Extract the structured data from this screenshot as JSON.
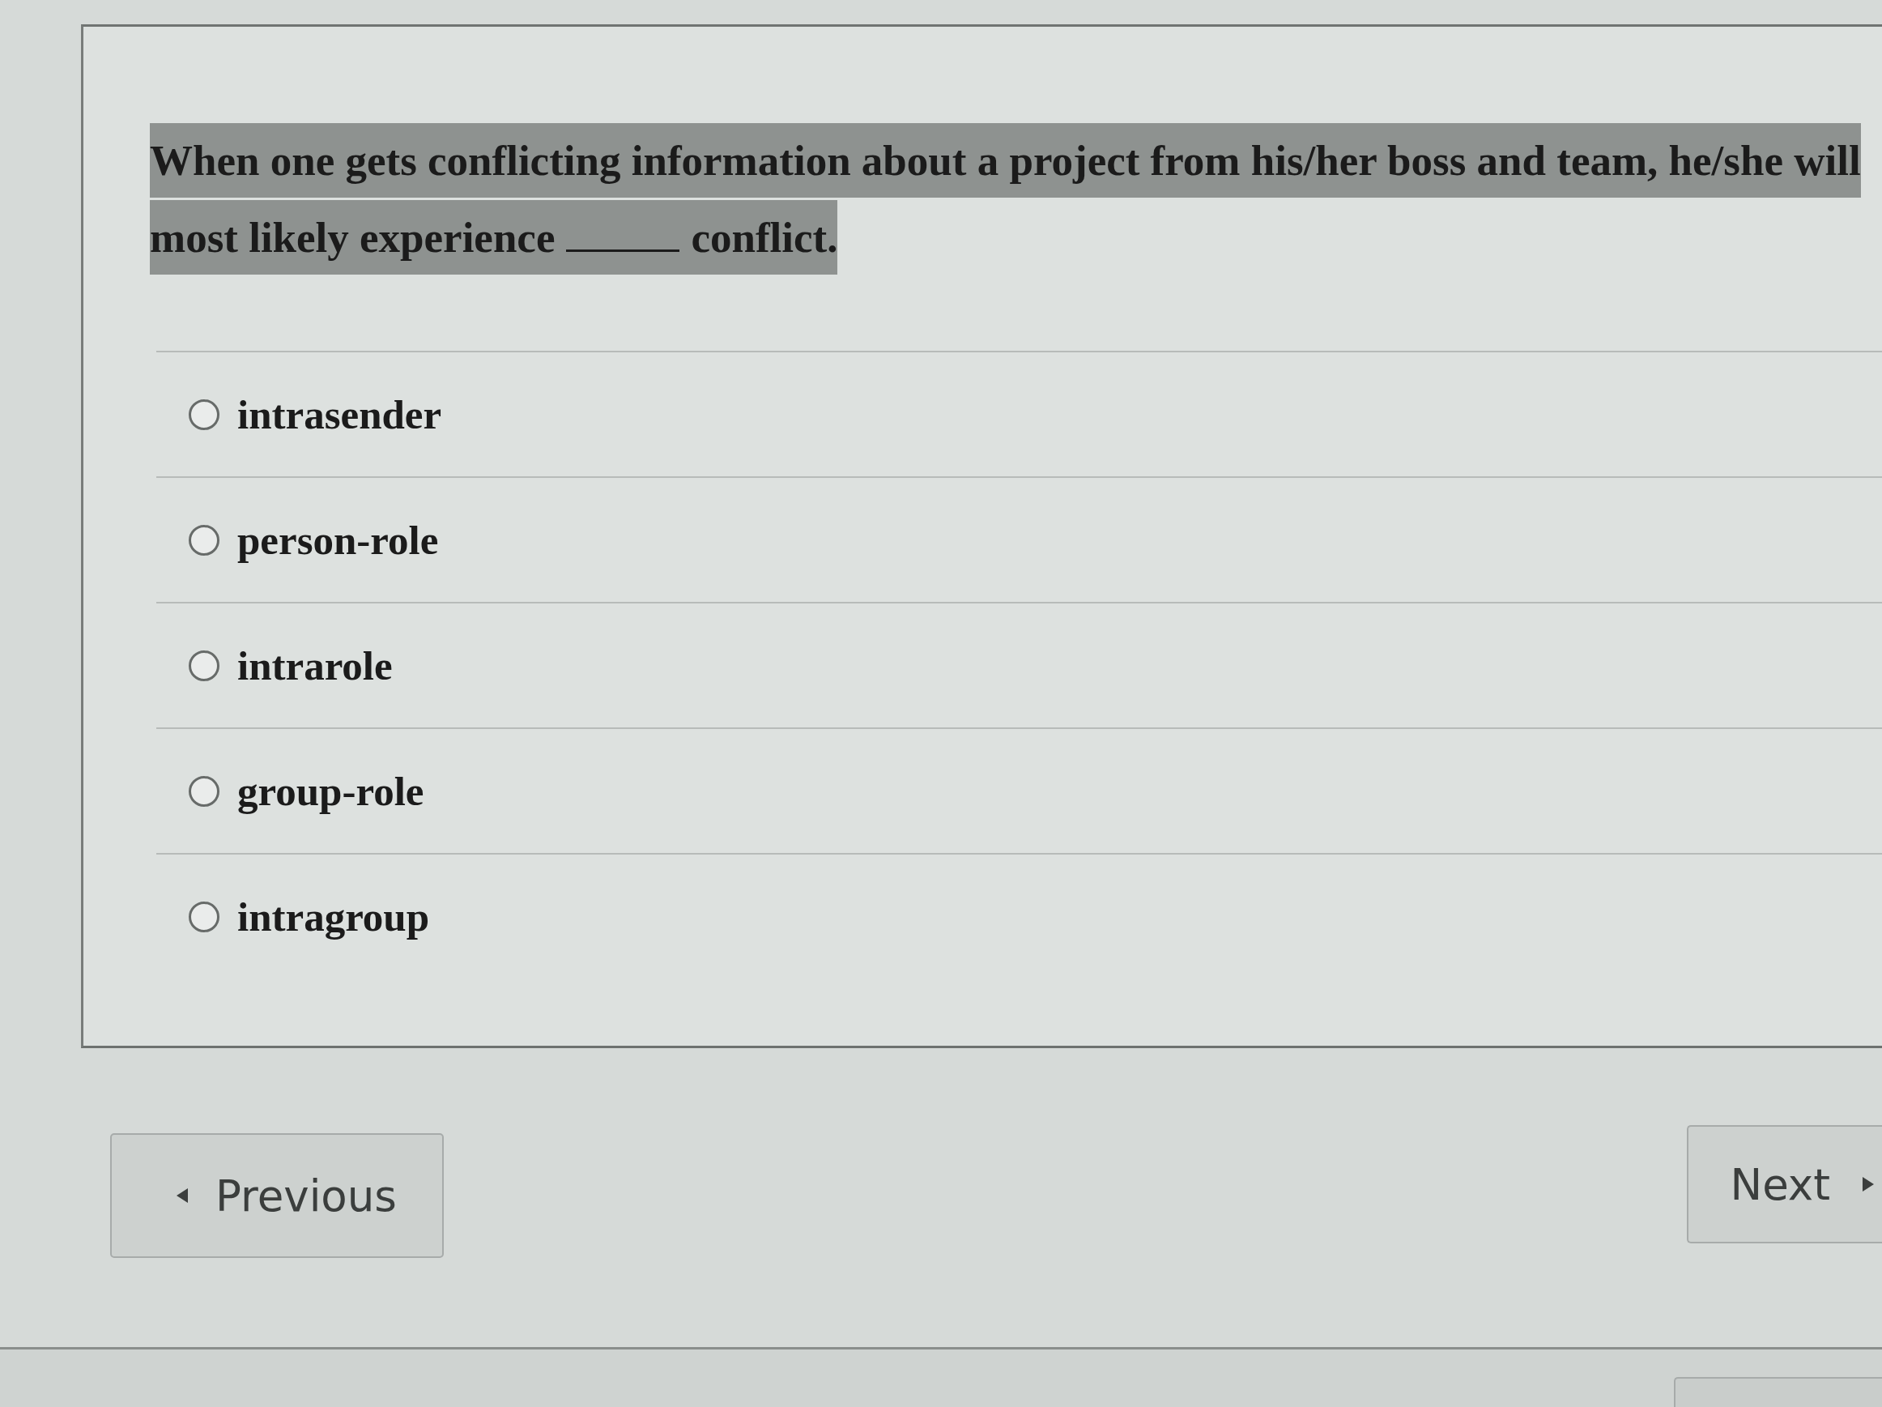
{
  "question": {
    "text_before_blank": "When one gets conflicting information about a project from his/her boss and team, he/she will most likely experience",
    "text_after_blank": "conflict.",
    "highlighted": true
  },
  "options": [
    {
      "label": "intrasender",
      "selected": false
    },
    {
      "label": "person-role",
      "selected": false
    },
    {
      "label": "intrarole",
      "selected": false
    },
    {
      "label": "group-role",
      "selected": false
    },
    {
      "label": "intragroup",
      "selected": false
    }
  ],
  "buttons": [
    {
      "kind": "previous",
      "label": "Previous"
    },
    {
      "kind": "next",
      "label": "Next"
    }
  ]
}
